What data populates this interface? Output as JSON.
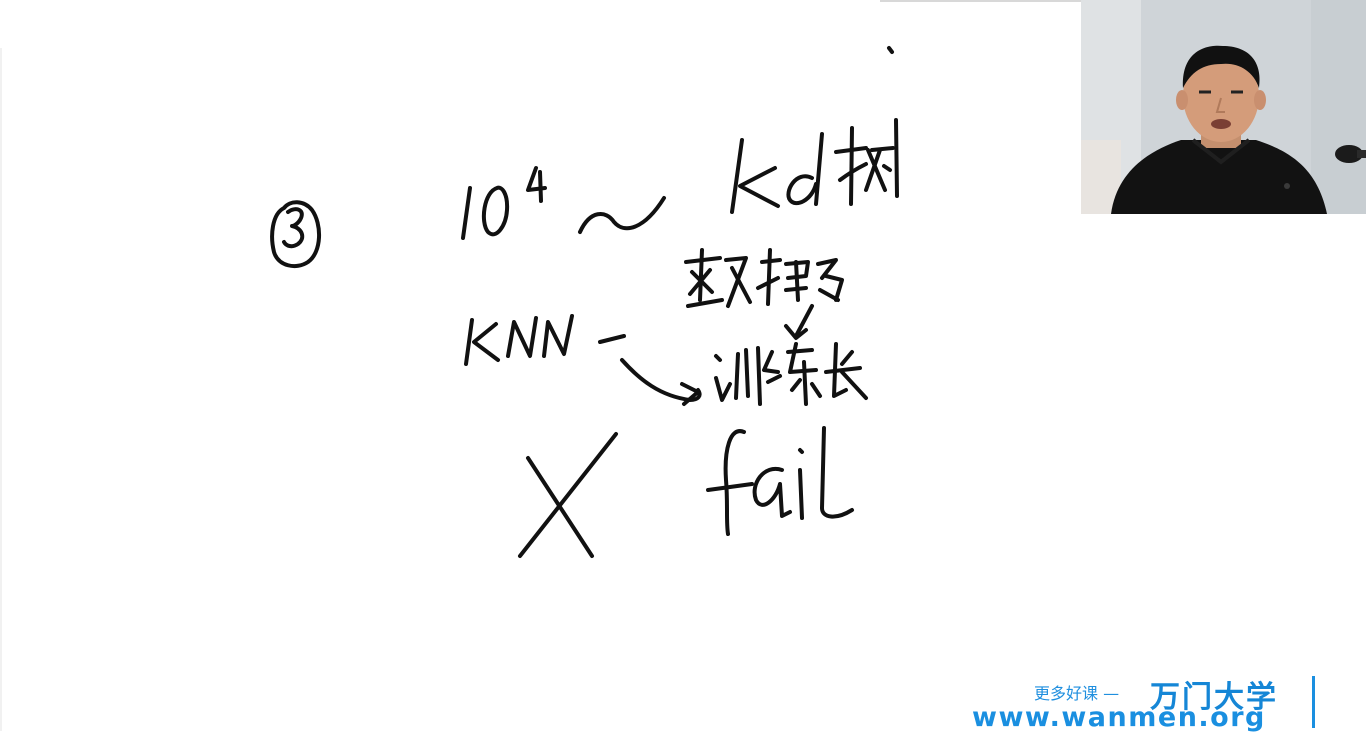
{
  "whiteboard": {
    "exponent_expression": "10^4",
    "tilde": "~",
    "kd_tree_text": "Kd 树",
    "circled_number": "3",
    "knn_text": "KNN -",
    "data_many_text": "数据多",
    "training_long_text": "训练长",
    "cross_mark": "X",
    "fail_text": "fail"
  },
  "branding": {
    "tagline": "更多好课 —",
    "name": "万门大学",
    "url": "www.wanmen.org"
  },
  "colors": {
    "ink": "#111111",
    "brand_blue": "#1a8fe0",
    "background": "#ffffff"
  }
}
